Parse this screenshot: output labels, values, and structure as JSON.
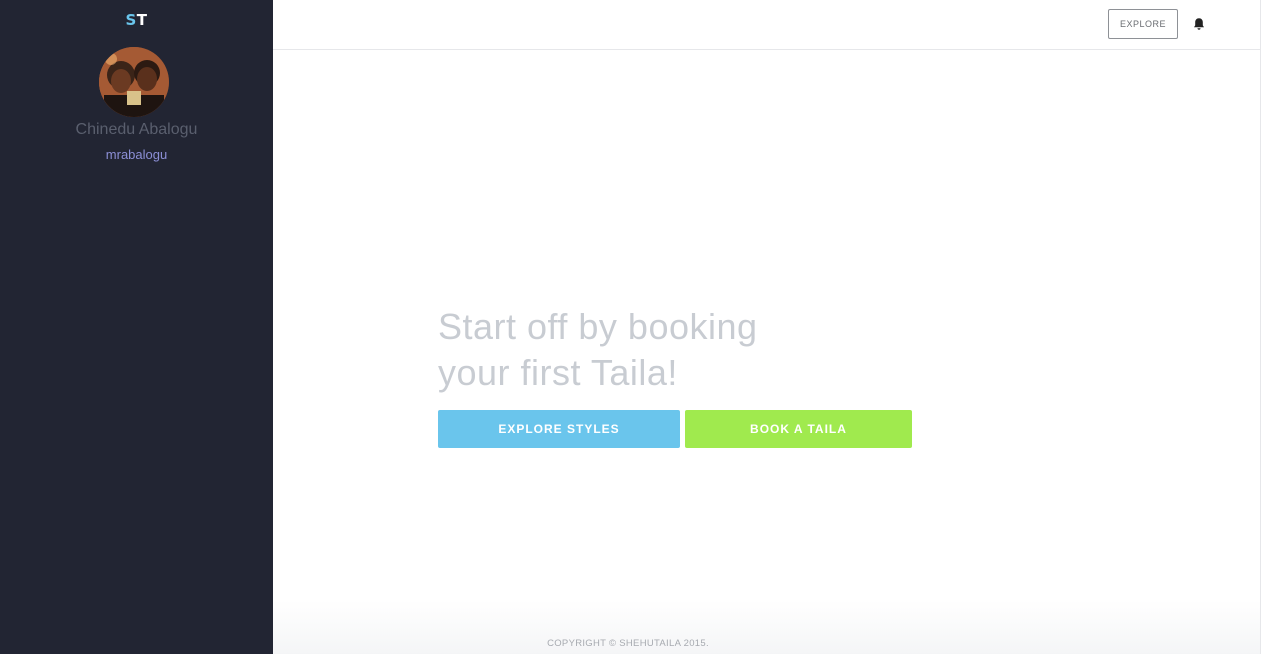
{
  "brand": {
    "logo_first": "S",
    "logo_second": "T"
  },
  "sidebar": {
    "user_name": "Chinedu Abalogu",
    "user_handle": "mrabalogu"
  },
  "header": {
    "explore_label": "EXPLORE",
    "bell_icon": "bell-icon"
  },
  "main": {
    "headline_line1": "Start off by booking",
    "headline_line2": "your first Taila!",
    "explore_styles_label": "EXPLORE STYLES",
    "book_taila_label": "BOOK A TAILA"
  },
  "footer": {
    "copyright": "COPYRIGHT © SHEHUTAILA 2015."
  },
  "colors": {
    "sidebar_bg": "#222533",
    "accent_blue": "#6ac5ec",
    "accent_green": "#a0ea4e",
    "handle_color": "#8c8fd6"
  }
}
